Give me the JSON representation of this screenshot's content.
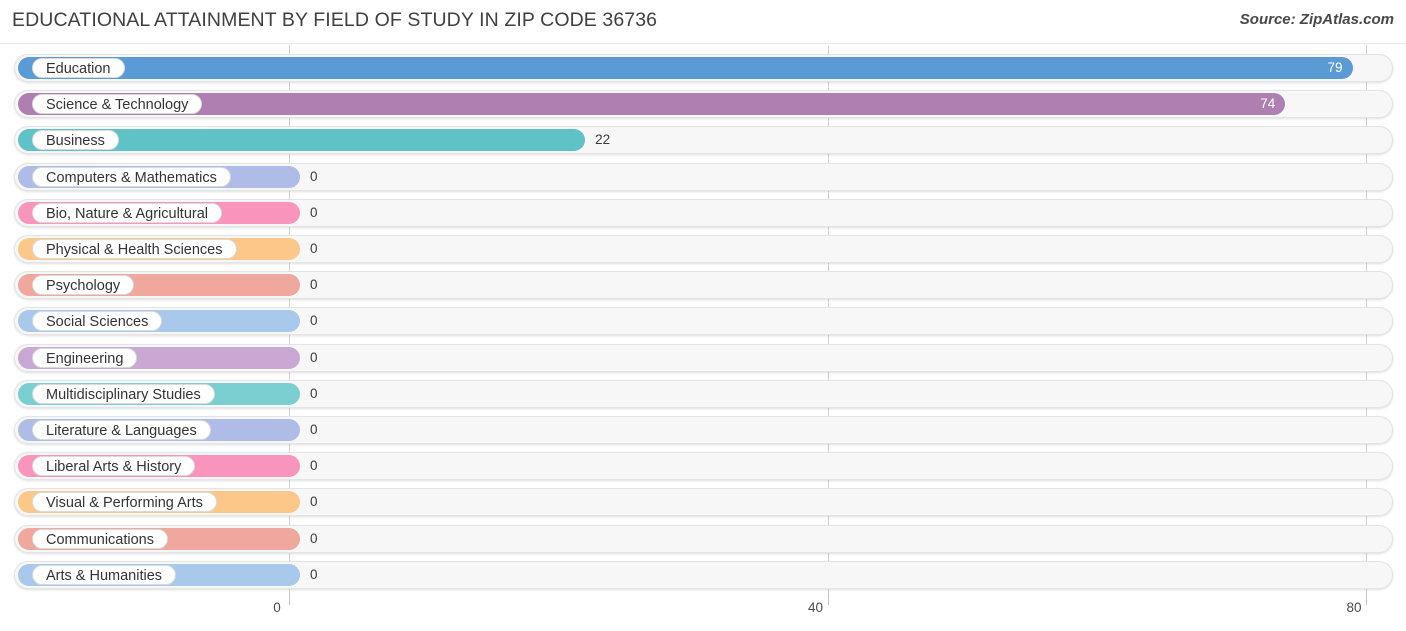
{
  "header": {
    "title": "EDUCATIONAL ATTAINMENT BY FIELD OF STUDY IN ZIP CODE 36736",
    "source": "Source: ZipAtlas.com"
  },
  "chart_data": {
    "type": "bar",
    "orientation": "horizontal",
    "title": "EDUCATIONAL ATTAINMENT BY FIELD OF STUDY IN ZIP CODE 36736",
    "xlabel": "",
    "ylabel": "",
    "xlim": [
      0,
      80
    ],
    "xticks": [
      0,
      40,
      80
    ],
    "xtick_labels": [
      "0",
      "40",
      "80"
    ],
    "grid": true,
    "legend": false,
    "categories": [
      "Education",
      "Science & Technology",
      "Business",
      "Computers & Mathematics",
      "Bio, Nature & Agricultural",
      "Physical & Health Sciences",
      "Psychology",
      "Social Sciences",
      "Engineering",
      "Multidisciplinary Studies",
      "Literature & Languages",
      "Liberal Arts & History",
      "Visual & Performing Arts",
      "Communications",
      "Arts & Humanities"
    ],
    "values": [
      79,
      74,
      22,
      0,
      0,
      0,
      0,
      0,
      0,
      0,
      0,
      0,
      0,
      0,
      0
    ],
    "value_labels": [
      "79",
      "74",
      "22",
      "0",
      "0",
      "0",
      "0",
      "0",
      "0",
      "0",
      "0",
      "0",
      "0",
      "0",
      "0"
    ],
    "colors": [
      "#5B9BD5",
      "#AE7FB0",
      "#5FC2C6",
      "#AFBCE8",
      "#F995BC",
      "#FBC88A",
      "#F0A79E",
      "#A8C8EC",
      "#C9A8D4",
      "#7CCFD0",
      "#AFBCE8",
      "#F995BC",
      "#FBC88A",
      "#F0A79E",
      "#A8C8EC"
    ]
  }
}
